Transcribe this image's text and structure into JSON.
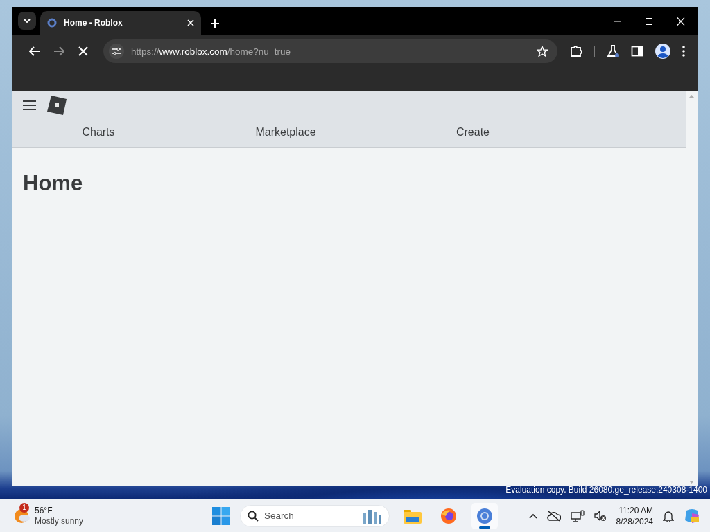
{
  "browser": {
    "tabs": [
      {
        "title": "Home - Roblox",
        "selected": true
      }
    ],
    "url": {
      "scheme": "https://",
      "host": "www.roblox.com",
      "path": "/home?nu=true"
    },
    "loading": true
  },
  "page": {
    "nav": [
      "Charts",
      "Marketplace",
      "Create"
    ],
    "heading": "Home"
  },
  "desktop": {
    "watermark": "Evaluation copy. Build 26080.ge_release.240308-1400"
  },
  "taskbar": {
    "weather": {
      "temperature": "56°F",
      "condition": "Mostly sunny",
      "badge": "1"
    },
    "search": {
      "placeholder": "Search"
    },
    "apps": [
      {
        "kind": "files",
        "selected": false
      },
      {
        "kind": "firefox",
        "selected": false
      },
      {
        "kind": "chrome",
        "selected": true
      }
    ],
    "clock": {
      "time": "11:20 AM",
      "date": "8/28/2024"
    }
  }
}
